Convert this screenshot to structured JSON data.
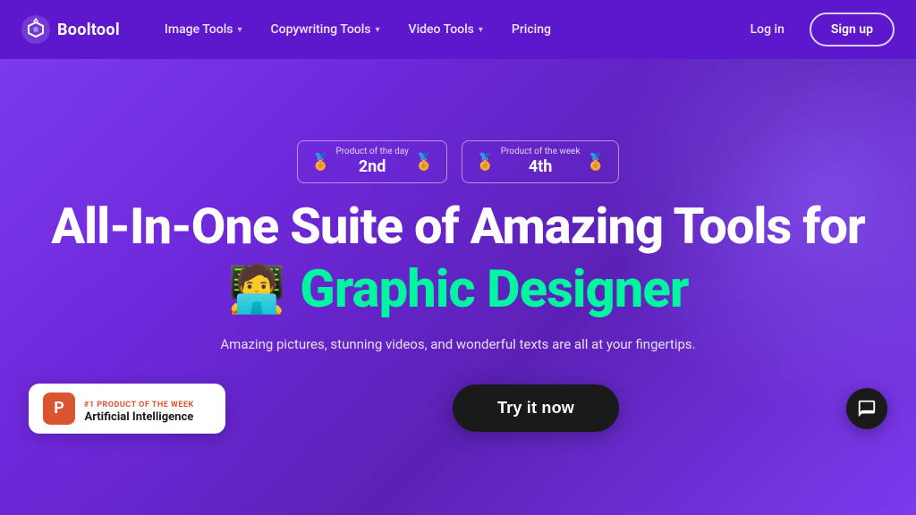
{
  "brand": {
    "name": "Booltool",
    "logo_alt": "Booltool logo"
  },
  "navbar": {
    "image_tools_label": "Image Tools",
    "copywriting_tools_label": "Copywriting Tools",
    "video_tools_label": "Video Tools",
    "pricing_label": "Pricing",
    "login_label": "Log in",
    "signup_label": "Sign up"
  },
  "hero": {
    "award1": {
      "label": "Product of the day",
      "rank": "2nd"
    },
    "award2": {
      "label": "Product of the week",
      "rank": "4th"
    },
    "headline": "All-In-One Suite of Amazing Tools for",
    "role": "Graphic Designer",
    "role_emoji": "🧑‍💻",
    "subtext": "Amazing pictures, stunning videos, and wonderful texts are all at your fingertips.",
    "try_now_label": "Try it now",
    "product_badge": {
      "top_label": "#1 PRODUCT OF THE WEEK",
      "main_label": "Artificial Intelligence"
    },
    "chat_icon": "chat-icon"
  }
}
